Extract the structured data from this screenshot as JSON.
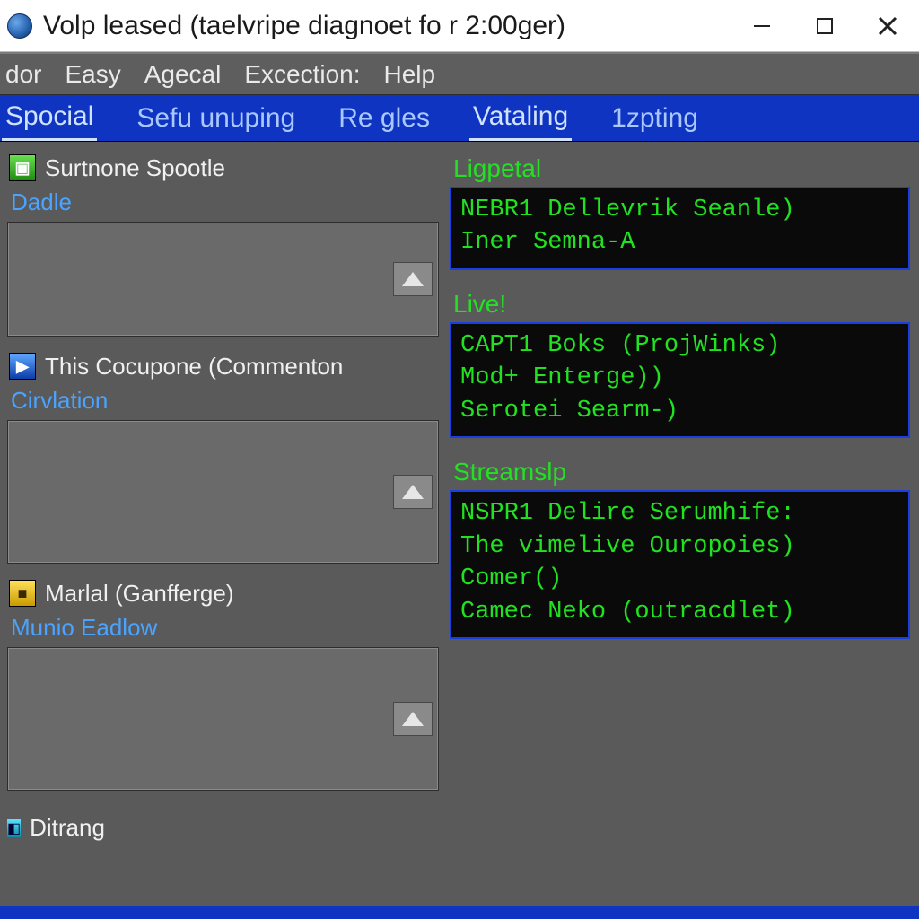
{
  "window": {
    "title": "Volp leased (taelvripe diagnoet fo r 2:00ger)"
  },
  "menubar": {
    "items": [
      "dor",
      "Easy",
      "Agecal",
      "Excection:",
      "Help"
    ]
  },
  "tabs": {
    "items": [
      "Spocial",
      "Sefu unuping",
      "Re gles",
      "Vataling",
      "1zpting"
    ],
    "active_index": 3
  },
  "left_panels": [
    {
      "icon": "green",
      "title": "Surtnone Spootle",
      "sub": "Dadle"
    },
    {
      "icon": "blue",
      "title": "This Cocupone (Commenton",
      "sub": "Cirvlation"
    },
    {
      "icon": "yellow",
      "title": "Marlal (Ganfferge)",
      "sub": "Munio Eadlow"
    }
  ],
  "footer_item": {
    "icon": "cyan",
    "title": "Ditrang"
  },
  "right_sections": [
    {
      "heading": "Ligpetal",
      "lines": [
        "NEBR1 Dellevrik Seanle)",
        "Iner Semna-A"
      ]
    },
    {
      "heading": "Live!",
      "lines": [
        "CAPT1 Boks (ProjWinks)",
        "Mod+ Enterge))",
        "Serotei Searm-)"
      ]
    },
    {
      "heading": "Streamslp",
      "lines": [
        "NSPR1 Delire Serumhife:",
        "The vimelive Ouropoies)",
        "Comer()",
        "Camec Neko (outracdlet)"
      ]
    }
  ]
}
